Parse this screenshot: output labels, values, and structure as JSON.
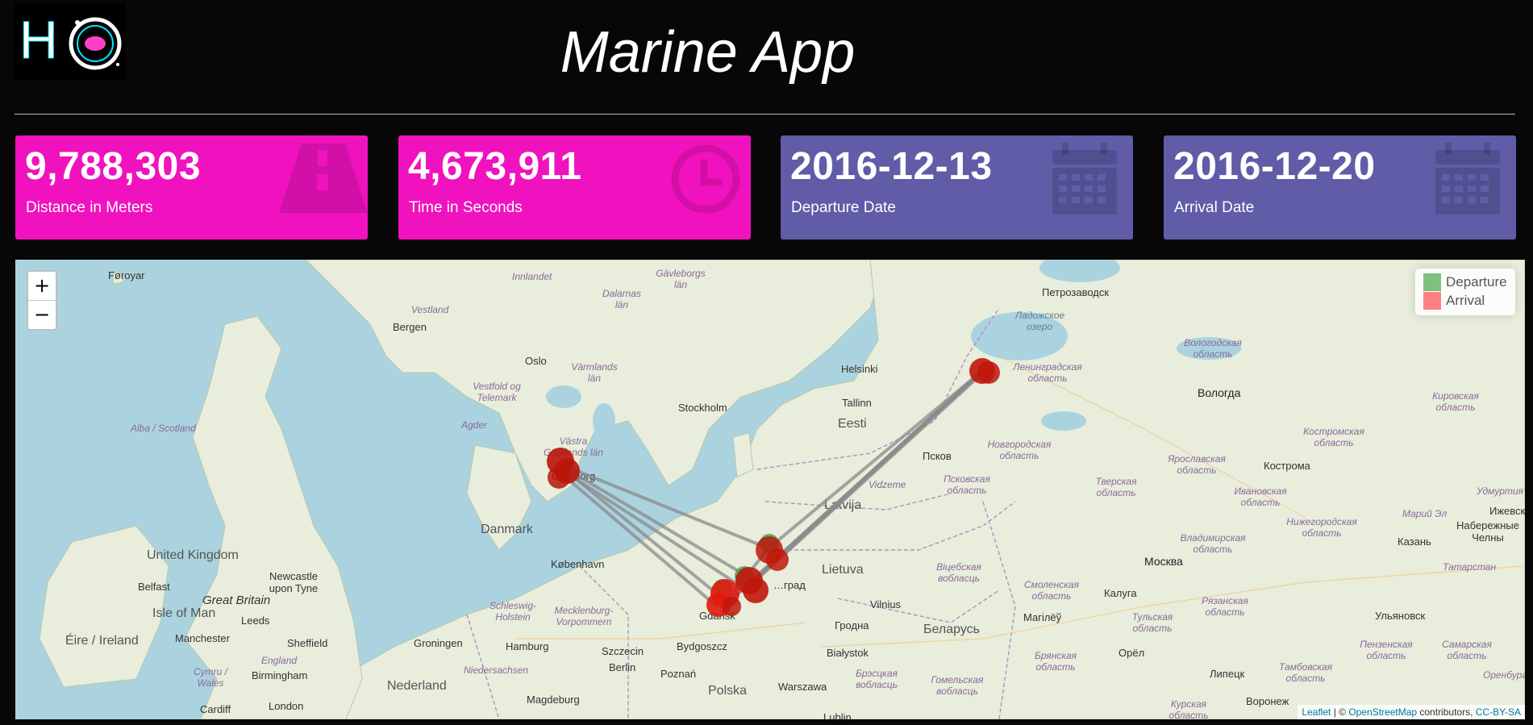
{
  "header": {
    "logo_text": "HO",
    "title": "Marine App"
  },
  "cards": [
    {
      "value": "9,788,303",
      "label": "Distance in Meters",
      "icon": "road-icon",
      "color": "#f012be"
    },
    {
      "value": "4,673,911",
      "label": "Time in Seconds",
      "icon": "clock-icon",
      "color": "#f012be"
    },
    {
      "value": "2016-12-13",
      "label": "Departure Date",
      "icon": "calendar-icon",
      "color": "#605ca8"
    },
    {
      "value": "2016-12-20",
      "label": "Arrival Date",
      "icon": "calendar-icon",
      "color": "#605ca8"
    }
  ],
  "map": {
    "zoom_in": "+",
    "zoom_out": "−",
    "legend": [
      {
        "label": "Departure",
        "color": "#7fbf7f"
      },
      {
        "label": "Arrival",
        "color": "#ff8080"
      }
    ],
    "attribution": {
      "leaflet": "Leaflet",
      "sep": " | © ",
      "osm": "OpenStreetMap",
      "contrib": " contributors, ",
      "license": "CC-BY-SA"
    },
    "places": {
      "foroyar": "Føroyar",
      "bergen": "Bergen",
      "vestland": "Vestland",
      "innlandet": "Innlandet",
      "dalarnas_lan": "Dalarnas län",
      "gavleborgs_lan": "Gävleborgs län",
      "oslo": "Oslo",
      "varmlands_lan": "Värmlands län",
      "vestfold": "Vestfold og Telemark",
      "agder": "Agder",
      "stockholm": "Stockholm",
      "vastra_gotaland": "Västra Götalands län",
      "goteborg": "Göteborg",
      "helsinki": "Helsinki",
      "tallinn": "Tallinn",
      "eesti": "Eesti",
      "petrozavodsk": "Петрозаводск",
      "ladoga": "Ладожское озеро",
      "leningrad_oblast": "Ленинградская область",
      "vologda_oblast": "Вологодская область",
      "vologda": "Вологда",
      "kirov_oblast": "Кировская область",
      "pskov": "Псков",
      "novgorod_oblast": "Новгородская область",
      "pskov_oblast": "Псковская область",
      "tver_oblast": "Тверская область",
      "yaroslavl_oblast": "Ярославская область",
      "kostroma_oblast": "Костромская область",
      "kostroma": "Кострома",
      "ivanovo_oblast": "Ивановская область",
      "udmurtia": "Удмуртия",
      "izhevsk": "Ижевск",
      "chelny": "Набережные Челны",
      "mari_el": "Марий Эл",
      "kazan": "Казань",
      "nn_oblast": "Нижегородская область",
      "vladimir_oblast": "Владимирская область",
      "tatarstan": "Татарстан",
      "moskva": "Москва",
      "vidzeme": "Vidzeme",
      "latvija": "Latvija",
      "lietuva": "Lietuva",
      "vitebsk": "Віцебская вобласць",
      "smolensk_oblast": "Смоленская область",
      "kaluga": "Калуга",
      "ryazan_oblast": "Рязанская область",
      "ulyanovsk": "Ульяновск",
      "tula_oblast": "Тульская область",
      "vilnius": "Vilnius",
      "magilev": "Магілёў",
      "grodno": "Гродна",
      "belarus": "Беларусь",
      "bialystok": "Białystok",
      "brest": "Брэсцкая вобласць",
      "gomel": "Гомельская вобласць",
      "bryansk_oblast": "Брянская область",
      "orel": "Орёл",
      "lipetsk": "Липецк",
      "tambov_oblast": "Тамбовская область",
      "penza_oblast": "Пензенская область",
      "samara_oblast": "Самарская область",
      "orenburg": "Оренбург",
      "voronezh": "Воронеж",
      "kursk_oblast": "Курская область",
      "lublin": "Lublin",
      "danmark": "Danmark",
      "kobenhavn": "København",
      "kaliningrad": "…град",
      "gdansk": "Gdańsk",
      "bydgoszcz": "Bydgoszcz",
      "szczecin": "Szczecin",
      "schleswig": "Schleswig-Holstein",
      "mecklenburg": "Mecklenburg-Vorpommern",
      "hamburg": "Hamburg",
      "groningen": "Groningen",
      "niedersachsen": "Niedersachsen",
      "berlin": "Berlin",
      "poznan": "Poznań",
      "magdeburg": "Magdeburg",
      "polska": "Polska",
      "warszawa": "Warszawa",
      "nederland": "Nederland",
      "alba": "Alba / Scotland",
      "united_kingdom": "United Kingdom",
      "great_britain": "Great Britain",
      "newcastle": "Newcastle upon Tyne",
      "belfast": "Belfast",
      "isle_of_man": "Isle of Man",
      "leeds": "Leeds",
      "eire": "Éire / Ireland",
      "manchester": "Manchester",
      "sheffield": "Sheffield",
      "england": "England",
      "cymru": "Cymru / Wales",
      "birmingham": "Birmingham",
      "london": "London",
      "cardiff": "Cardiff"
    }
  }
}
